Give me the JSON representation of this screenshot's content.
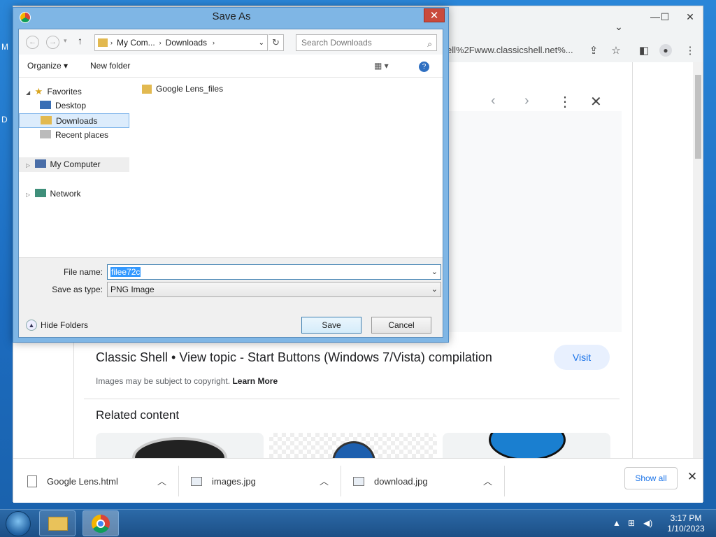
{
  "desktop": {
    "left_letters": [
      "M",
      "D"
    ]
  },
  "chrome": {
    "omnibox_text": "ell%2Fwww.classicshell.net%...",
    "window_controls": {
      "minimize": "—",
      "maximize": "☐",
      "close": "✕"
    },
    "tab_chevron": "⌄",
    "toolbar_icons": [
      "share-icon",
      "star-icon",
      "sidepanel-icon",
      "profile-icon",
      "menu-icon"
    ]
  },
  "lens": {
    "title": "Classic Shell • View topic - Start Buttons (Windows 7/Vista) compilation",
    "visit": "Visit",
    "copyright": "Images may be subject to copyright.",
    "learn_more": "Learn More",
    "related": "Related content"
  },
  "downloads": {
    "items": [
      {
        "name": "Google Lens.html"
      },
      {
        "name": "images.jpg"
      },
      {
        "name": "download.jpg"
      }
    ],
    "show_all": "Show all"
  },
  "dialog": {
    "title": "Save As",
    "address": {
      "root": "My Com...",
      "folder": "Downloads"
    },
    "search_placeholder": "Search Downloads",
    "organize": "Organize",
    "new_folder": "New folder",
    "nav": {
      "favorites": "Favorites",
      "desktop": "Desktop",
      "downloads": "Downloads",
      "recent": "Recent places",
      "computer": "My Computer",
      "network": "Network"
    },
    "files": [
      {
        "name": "Google Lens_files"
      }
    ],
    "file_name_label": "File name:",
    "file_name_value": "filee72c",
    "save_type_label": "Save as type:",
    "save_type_value": "PNG Image",
    "save": "Save",
    "cancel": "Cancel",
    "hide_folders": "Hide Folders"
  },
  "taskbar": {
    "time": "3:17 PM",
    "date": "1/10/2023"
  }
}
